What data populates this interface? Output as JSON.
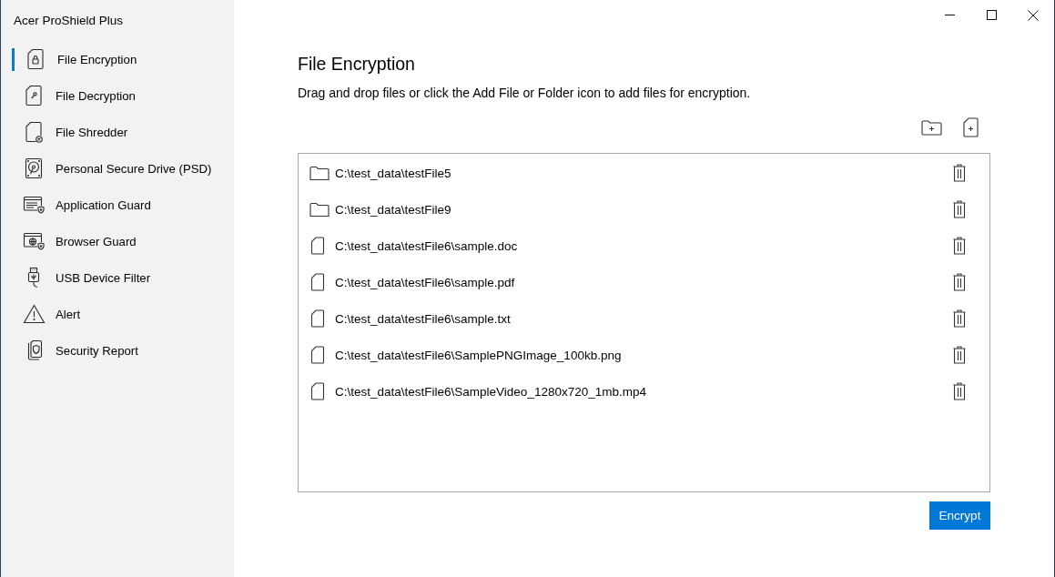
{
  "window": {
    "title": "Acer ProShield Plus"
  },
  "sidebar": {
    "items": [
      {
        "label": "File Encryption",
        "selected": true
      },
      {
        "label": "File Decryption",
        "selected": false
      },
      {
        "label": "File Shredder",
        "selected": false
      },
      {
        "label": "Personal Secure Drive (PSD)",
        "selected": false
      },
      {
        "label": "Application Guard",
        "selected": false
      },
      {
        "label": "Browser Guard",
        "selected": false
      },
      {
        "label": "USB Device Filter",
        "selected": false
      },
      {
        "label": "Alert",
        "selected": false
      },
      {
        "label": "Security Report",
        "selected": false
      }
    ]
  },
  "page": {
    "title": "File Encryption",
    "description": "Drag and drop files or click the Add File or Folder icon to add files for encryption."
  },
  "files": [
    {
      "kind": "folder",
      "path": "C:\\test_data\\testFile5"
    },
    {
      "kind": "folder",
      "path": "C:\\test_data\\testFile9"
    },
    {
      "kind": "file",
      "path": "C:\\test_data\\testFile6\\sample.doc"
    },
    {
      "kind": "file",
      "path": "C:\\test_data\\testFile6\\sample.pdf"
    },
    {
      "kind": "file",
      "path": "C:\\test_data\\testFile6\\sample.txt"
    },
    {
      "kind": "file",
      "path": "C:\\test_data\\testFile6\\SamplePNGImage_100kb.png"
    },
    {
      "kind": "file",
      "path": "C:\\test_data\\testFile6\\SampleVideo_1280x720_1mb.mp4"
    }
  ],
  "encrypt_button": {
    "label": "Encrypt"
  }
}
